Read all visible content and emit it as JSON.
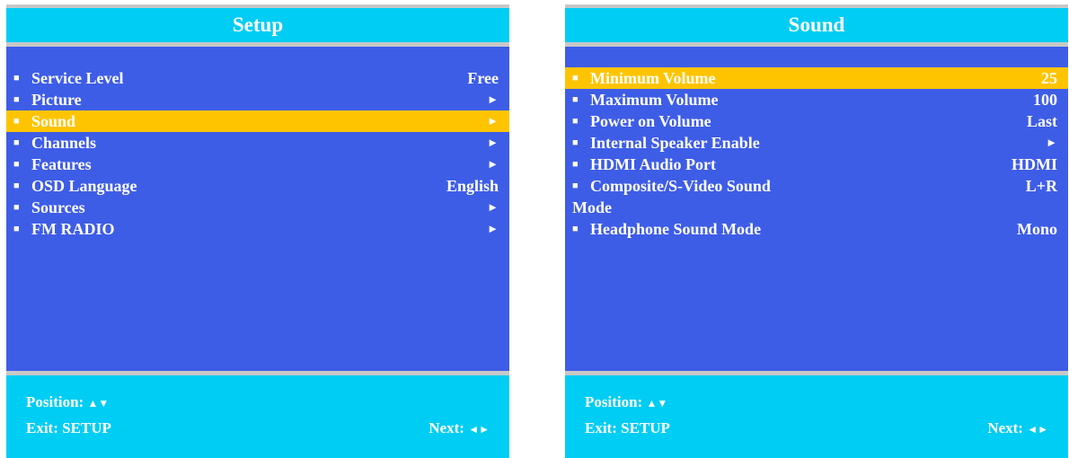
{
  "setup": {
    "title": "Setup",
    "items": [
      {
        "label": "Service Level",
        "value": "Free"
      },
      {
        "label": "Picture",
        "value": "►"
      },
      {
        "label": "Sound",
        "value": "►"
      },
      {
        "label": "Channels",
        "value": "►"
      },
      {
        "label": "Features",
        "value": "►"
      },
      {
        "label": "OSD Language",
        "value": "English"
      },
      {
        "label": "Sources",
        "value": "►"
      },
      {
        "label": "FM RADIO",
        "value": "►"
      }
    ],
    "footer": {
      "position_label": "Position:",
      "position_symbols": "▲▼",
      "exit_label": "Exit: SETUP",
      "next_label": "Next:",
      "next_symbols": "◄►"
    }
  },
  "sound": {
    "title": "Sound",
    "items": [
      {
        "label": "Minimum Volume",
        "value": "25"
      },
      {
        "label": "Maximum Volume",
        "value": "100"
      },
      {
        "label": "Power on Volume",
        "value": "Last"
      },
      {
        "label": "Internal Speaker Enable",
        "value": "►"
      },
      {
        "label": "HDMI Audio Port",
        "value": "HDMI"
      },
      {
        "label": "Composite/S-Video Sound",
        "value": "L+R"
      },
      {
        "label": "Headphone Sound Mode",
        "value": "Mono"
      }
    ],
    "composite_wrap": "Mode",
    "footer": {
      "position_label": "Position:",
      "position_symbols": "▲▼",
      "exit_label": "Exit: SETUP",
      "next_label": "Next:",
      "next_symbols": "◄►"
    }
  },
  "colors": {
    "panel": "#3e5de6",
    "title_bar": "#00cdf3",
    "highlight": "#ffc400",
    "border": "#c7c7c7",
    "text": "#ffffff"
  },
  "highlighted": {
    "setup": "Sound",
    "sound": "Minimum Volume"
  }
}
